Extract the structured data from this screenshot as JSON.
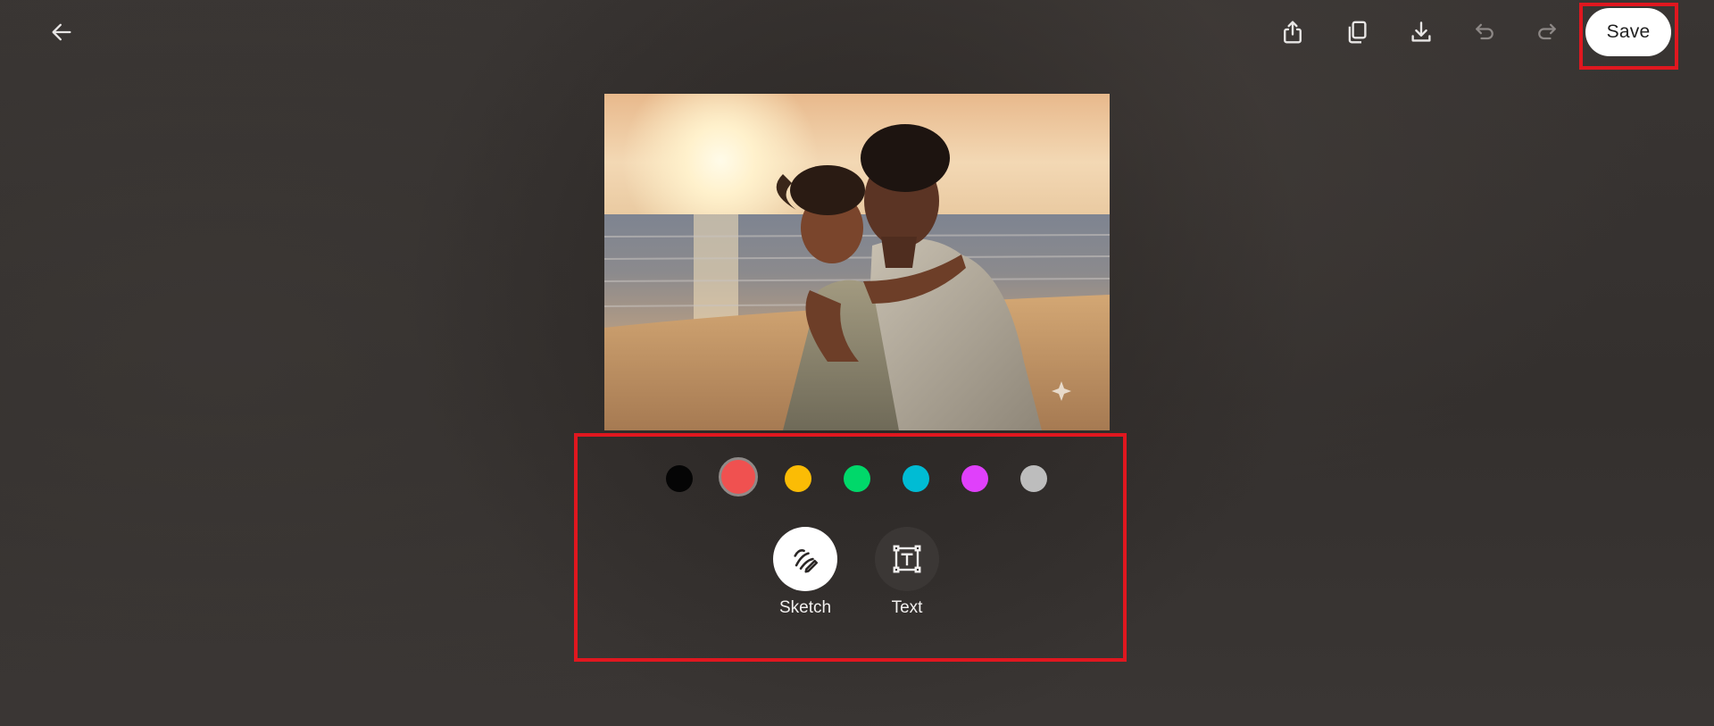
{
  "toolbar": {
    "back_icon": "arrow-left-icon",
    "share_icon": "share-icon",
    "copy_icon": "copy-icon",
    "download_icon": "download-icon",
    "undo_icon": "undo-icon",
    "redo_icon": "redo-icon",
    "save_label": "Save"
  },
  "palette": {
    "colors": [
      "#050505",
      "#f05150",
      "#fbbc05",
      "#00d86a",
      "#00bcd4",
      "#e040fb",
      "#bdbdbd"
    ],
    "selected_index": 1
  },
  "tools": {
    "sketch_label": "Sketch",
    "text_label": "Text",
    "active": "Sketch"
  },
  "colors": {
    "highlight": "#e0171f",
    "save_bg": "#ffffff"
  }
}
